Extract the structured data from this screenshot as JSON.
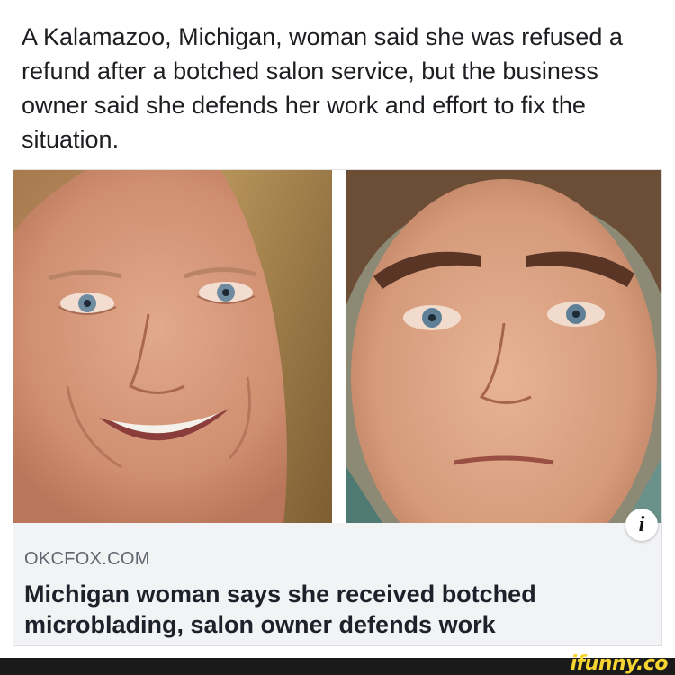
{
  "post": {
    "text": "A Kalamazoo, Michigan, woman said she was refused a refund after a botched salon service, but the business owner said she defends her work and effort to fix the situation."
  },
  "link_card": {
    "source": "OKCFOX.COM",
    "headline": "Michigan woman says she received botched microblading, salon owner defends work",
    "info_icon": "info-icon",
    "images": [
      "before-photo",
      "after-photo"
    ]
  },
  "footer": {
    "watermark": "ifunny.co"
  },
  "colors": {
    "text": "#1c1e21",
    "source_gray": "#606770",
    "card_bg": "#f2f3f5",
    "watermark_yellow": "#f6d531"
  }
}
